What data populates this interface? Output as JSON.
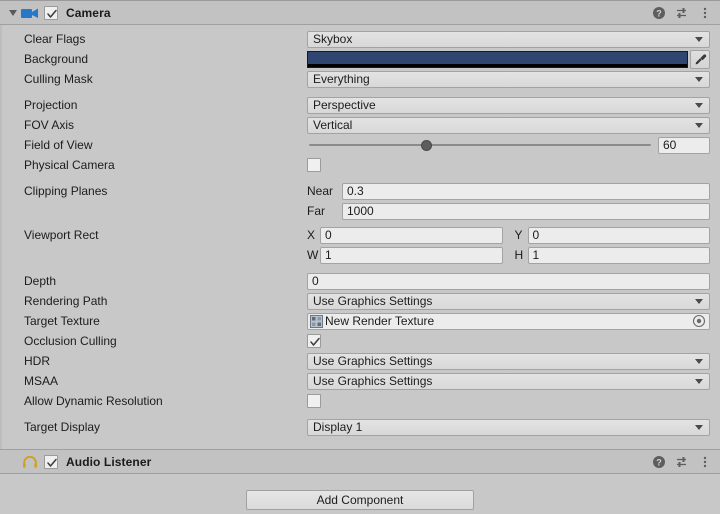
{
  "camera_component": {
    "title": "Camera",
    "icon": "camera-icon",
    "enabled": true,
    "expanded": true,
    "header_icons": {
      "help": "help-icon",
      "preset": "preset-icon",
      "menu": "kebab-menu-icon"
    },
    "rows": {
      "clear_flags": {
        "label": "Clear Flags",
        "value": "Skybox"
      },
      "background": {
        "label": "Background",
        "color": "#2F4670",
        "alpha_color": "#000000",
        "eyedropper": "eyedropper-icon"
      },
      "culling_mask": {
        "label": "Culling Mask",
        "value": "Everything"
      },
      "projection": {
        "label": "Projection",
        "value": "Perspective"
      },
      "fov_axis": {
        "label": "FOV Axis",
        "value": "Vertical"
      },
      "field_of_view": {
        "label": "Field of View",
        "value": "60",
        "slider_percent": 33
      },
      "physical_camera": {
        "label": "Physical Camera",
        "checked": false
      },
      "clipping_planes": {
        "label": "Clipping Planes",
        "near_label": "Near",
        "near_value": "0.3",
        "far_label": "Far",
        "far_value": "1000"
      },
      "viewport_rect": {
        "label": "Viewport Rect",
        "x_label": "X",
        "x_value": "0",
        "y_label": "Y",
        "y_value": "0",
        "w_label": "W",
        "w_value": "1",
        "h_label": "H",
        "h_value": "1"
      },
      "depth": {
        "label": "Depth",
        "value": "0"
      },
      "rendering_path": {
        "label": "Rendering Path",
        "value": "Use Graphics Settings"
      },
      "target_texture": {
        "label": "Target Texture",
        "value": "New Render Texture",
        "icon": "render-texture-icon",
        "picker": "object-picker-icon"
      },
      "occlusion_culling": {
        "label": "Occlusion Culling",
        "checked": true
      },
      "hdr": {
        "label": "HDR",
        "value": "Use Graphics Settings"
      },
      "msaa": {
        "label": "MSAA",
        "value": "Use Graphics Settings"
      },
      "allow_dynamic_resolution": {
        "label": "Allow Dynamic Resolution",
        "checked": false
      },
      "target_display": {
        "label": "Target Display",
        "value": "Display 1"
      }
    }
  },
  "audio_listener_component": {
    "title": "Audio Listener",
    "icon": "headphones-icon",
    "enabled": true,
    "header_icons": {
      "help": "help-icon",
      "preset": "preset-icon",
      "menu": "kebab-menu-icon"
    }
  },
  "footer": {
    "add_component_label": "Add Component"
  }
}
